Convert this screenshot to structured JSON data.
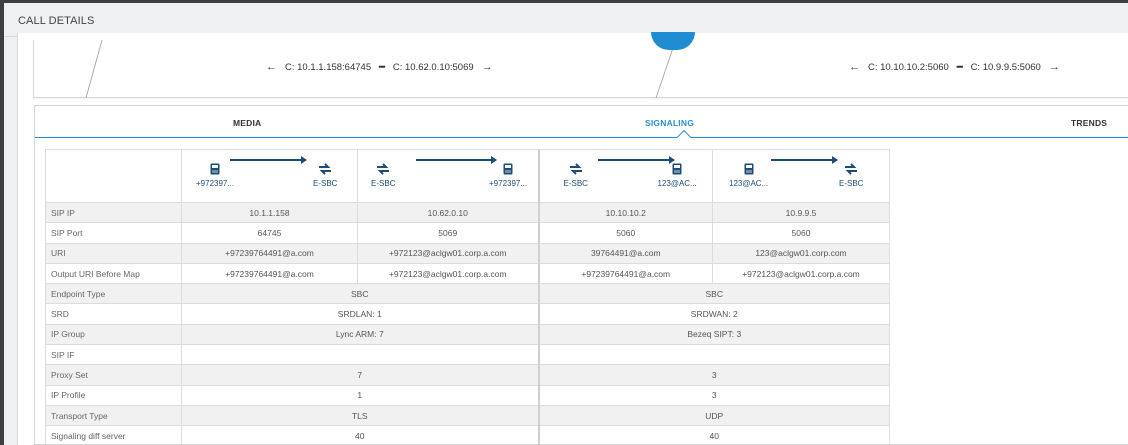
{
  "panel": {
    "title": "CALL DETAILS"
  },
  "flow": {
    "leg1": {
      "left_arrow": "←",
      "from": "C: 10.1.1.158:64745",
      "sep": "━",
      "to": "C: 10.62.0.10:5069",
      "right_arrow": "→"
    },
    "leg2": {
      "left_arrow": "←",
      "from": "C: 10.10.10.2:5060",
      "sep": "━",
      "to": "C: 10.9.9.5:5060",
      "right_arrow": "→"
    }
  },
  "tabs": [
    {
      "label": "MEDIA",
      "active": false
    },
    {
      "label": "SIGNALING",
      "active": true
    },
    {
      "label": "TRENDS",
      "active": false
    }
  ],
  "endpoints": [
    {
      "left": "+972397...",
      "right": "E-SBC",
      "left_icon": "phone-icon",
      "right_icon": "sbc-icon"
    },
    {
      "left": "E-SBC",
      "right": "+972397...",
      "left_icon": "sbc-icon",
      "right_icon": "phone-icon"
    },
    {
      "left": "E-SBC",
      "right": "123@AC...",
      "left_icon": "sbc-icon",
      "right_icon": "phone-icon"
    },
    {
      "left": "123@AC...",
      "right": "E-SBC",
      "left_icon": "phone-icon",
      "right_icon": "sbc-icon"
    }
  ],
  "rows": {
    "sip_ip": {
      "label": "SIP IP",
      "v": [
        "10.1.1.158",
        "10.62.0.10",
        "10.10.10.2",
        "10.9.9.5"
      ]
    },
    "sip_port": {
      "label": "SIP Port",
      "v": [
        "64745",
        "5069",
        "5060",
        "5060"
      ]
    },
    "uri": {
      "label": "URI",
      "v": [
        "+97239764491@a.com",
        "+972123@aclgw01.corp.a.com",
        "39764491@a.com",
        "123@aclgw01.corp.com"
      ]
    },
    "output_uri": {
      "label": "Output URI Before Map",
      "v": [
        "+97239764491@a.com",
        "+972123@aclgw01.corp.a.com",
        "+97239764491@a.com",
        "+972123@aclgw01.corp.a.com"
      ]
    },
    "endpoint_type": {
      "label": "Endpoint Type",
      "v": [
        "SBC",
        "SBC"
      ]
    },
    "srd": {
      "label": "SRD",
      "v": [
        "SRDLAN: 1",
        "SRDWAN: 2"
      ]
    },
    "ip_group": {
      "label": "IP Group",
      "v": [
        "Lync ARM: 7",
        "Bezeq SIPT: 3"
      ]
    },
    "sip_if": {
      "label": "SIP IF",
      "v": [
        "",
        ""
      ]
    },
    "proxy_set": {
      "label": "Proxy Set",
      "v": [
        "7",
        "3"
      ]
    },
    "ip_profile": {
      "label": "IP Profile",
      "v": [
        "1",
        "3"
      ]
    },
    "transport": {
      "label": "Transport Type",
      "v": [
        "TLS",
        "UDP"
      ]
    },
    "sig_diff": {
      "label": "Signaling diff server",
      "v": [
        "40",
        "40"
      ]
    }
  },
  "colors": {
    "accent": "#2c8fd3",
    "icon": "#1e4c79",
    "node": "#1f8bd0"
  }
}
